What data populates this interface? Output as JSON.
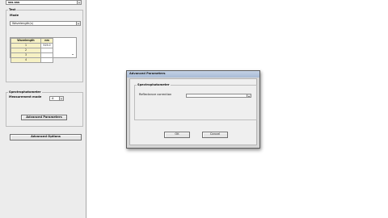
{
  "left_panel": {
    "top_select": {
      "value": "sss.sss"
    },
    "test_group": {
      "title": "Test",
      "mode_label": "Mode",
      "mode_value": "Wavelength(s)",
      "table": {
        "headers": [
          "Wavelength",
          "nm"
        ],
        "rows": [
          {
            "num": "1",
            "value": "525.0"
          },
          {
            "num": "2",
            "value": ""
          },
          {
            "num": "3",
            "value": ""
          },
          {
            "num": "4",
            "value": ""
          }
        ]
      }
    },
    "spectro_group": {
      "title": "Spectrophotometer",
      "measurement_mode_label": "Measurement mode",
      "measurement_mode_value": "A",
      "advanced_parameters_label": "Advanced Parameters"
    },
    "advanced_options_label": "Advanced Options"
  },
  "dialog": {
    "title": "Advanced Parameters",
    "group_title": "Spectrophotometer",
    "reflectance_label": "Reflectance correction",
    "reflectance_value": "",
    "ok_label": "OK",
    "cancel_label": "Cancel"
  }
}
